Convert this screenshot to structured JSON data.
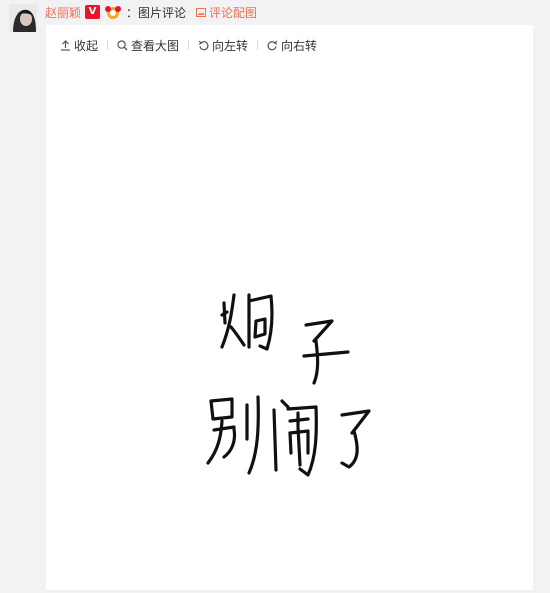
{
  "comment": {
    "username": "赵丽颖",
    "verified_badge": "V",
    "comment_label": "：图片评论",
    "reply_with_image_label": "评论配图",
    "avatar_icon": "avatar-image"
  },
  "toolbar": {
    "items": [
      {
        "label": "收起",
        "icon": "collapse-up-icon"
      },
      {
        "label": "查看大图",
        "icon": "magnifier-icon"
      },
      {
        "label": "向左转",
        "icon": "rotate-left-icon"
      },
      {
        "label": "向右转",
        "icon": "rotate-right-icon"
      }
    ]
  },
  "image": {
    "handwriting_line1": "炯子",
    "handwriting_line2": "别闹了"
  },
  "colors": {
    "accent": "#eb7350",
    "badge_red": "#e6162d",
    "page_bg": "#f2f2f5",
    "card_bg": "#ffffff"
  }
}
